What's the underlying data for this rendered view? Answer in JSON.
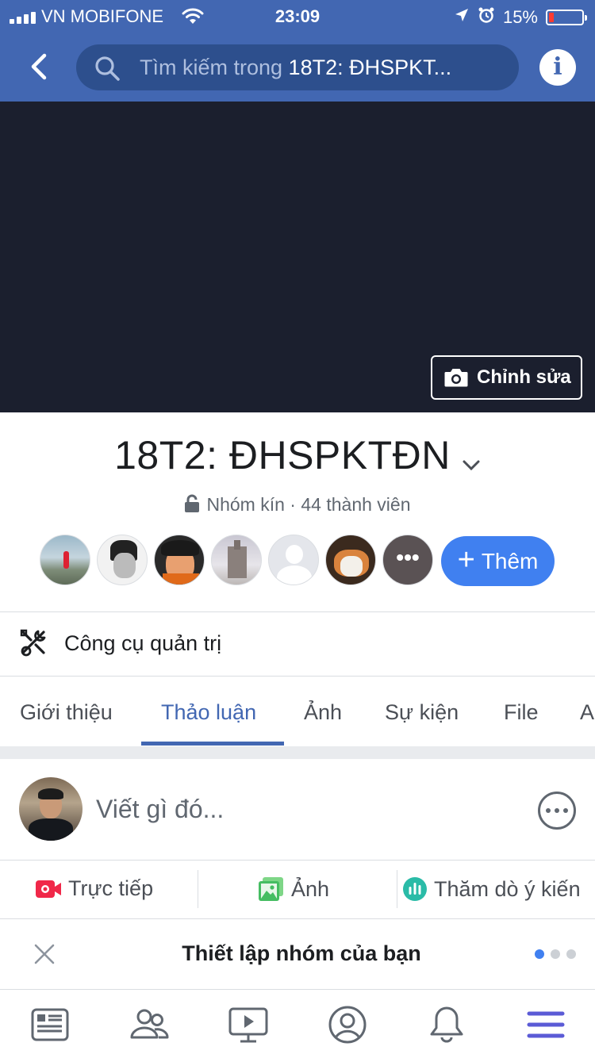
{
  "status": {
    "carrier": "VN MOBIFONE",
    "time": "23:09",
    "battery": "15%",
    "battery_level": 0.15
  },
  "header": {
    "search_prefix": "Tìm kiếm trong ",
    "search_group": "18T2: ĐHSPKT..."
  },
  "cover": {
    "edit_label": "Chỉnh sửa",
    "bg_color": "#1b1f2e"
  },
  "group": {
    "name": "18T2: ĐHSPKTĐN",
    "privacy": "Nhóm kín",
    "members": "44 thành viên",
    "add_label": "Thêm",
    "more_label": "•••"
  },
  "admin": {
    "label": "Công cụ quản trị"
  },
  "tabs": [
    "Giới thiệu",
    "Thảo luận",
    "Ảnh",
    "Sự kiện",
    "File",
    "A"
  ],
  "active_tab": "Thảo luận",
  "composer": {
    "placeholder": "Viết gì đó..."
  },
  "actions": {
    "live": "Trực tiếp",
    "photo": "Ảnh",
    "poll": "Thăm dò ý kiến"
  },
  "setup": {
    "title": "Thiết lập nhóm của bạn"
  },
  "colors": {
    "brand": "#4267b2",
    "accent": "#4080f0",
    "live_red": "#f02849",
    "photo_green": "#45bd62",
    "poll_teal": "#2abba7"
  },
  "bottom_nav": [
    "news-feed-icon",
    "groups-icon",
    "watch-icon",
    "profile-icon",
    "notifications-icon",
    "menu-icon"
  ]
}
